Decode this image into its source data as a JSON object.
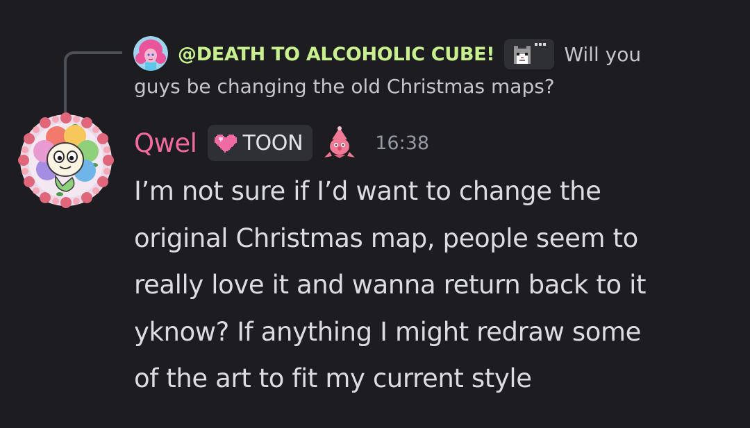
{
  "reply": {
    "author": "@DEATH TO ALCOHOLIC CUBE!",
    "badge_icon": "pixel-cat-icon",
    "text_line1": "Will you",
    "text_line2": "guys be changing the old Christmas maps?"
  },
  "message": {
    "username": "Qwel",
    "tag_icon": "pink-heart-icon",
    "tag_label": "TOON",
    "decoration_icon": "party-hat-character-icon",
    "timestamp": "16:38",
    "lines": [
      "I’m not sure if I’d want to change the",
      "original Christmas map, people seem to",
      "really love it and wanna return back to it",
      "yknow? If anything I might redraw some",
      "of the art to fit my current style"
    ]
  },
  "colors": {
    "background": "#1d1d21",
    "reply_author": "#c8f08f",
    "username": "#f36a9e",
    "body_text": "#dcdde1",
    "timestamp": "#949ba4"
  }
}
